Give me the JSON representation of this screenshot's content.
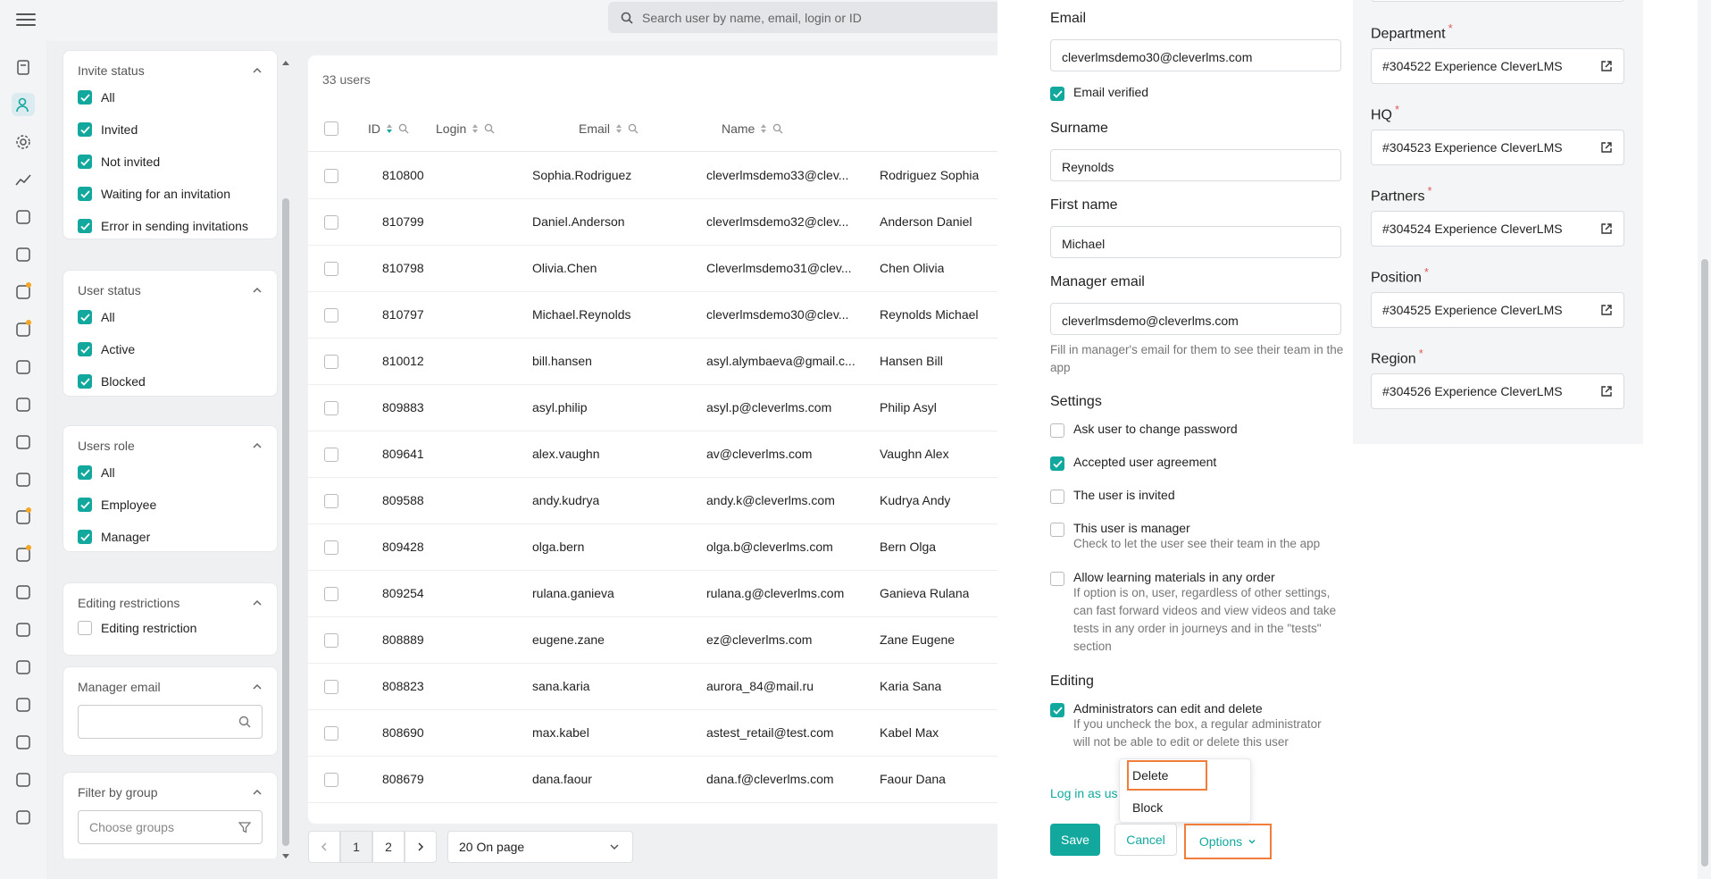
{
  "topbar": {
    "search_placeholder": "Search user by name, email, login or ID"
  },
  "rail": {
    "icons": [
      "edit-doc-icon",
      "users-icon",
      "gear-icon",
      "chart-icon",
      "clipboard-icon",
      "document-icon",
      "tools-icon",
      "target-icon",
      "checklist-icon",
      "help-bubble-icon",
      "calendar-icon",
      "info-icon",
      "chat-icon",
      "video-icon",
      "trophy-icon",
      "gift-icon",
      "user-check-icon",
      "trend-icon",
      "star-icon",
      "monitor-icon",
      "export-icon"
    ],
    "active": "users-icon",
    "accent": "#13a89e",
    "badge_color": "#f5a623"
  },
  "filters": {
    "invite_status": {
      "title": "Invite status",
      "options": [
        {
          "label": "All",
          "checked": true
        },
        {
          "label": "Invited",
          "checked": true
        },
        {
          "label": "Not invited",
          "checked": true
        },
        {
          "label": "Waiting for an invitation",
          "checked": true
        },
        {
          "label": "Error in sending invitations",
          "checked": true
        }
      ]
    },
    "user_status": {
      "title": "User status",
      "options": [
        {
          "label": "All",
          "checked": true
        },
        {
          "label": "Active",
          "checked": true
        },
        {
          "label": "Blocked",
          "checked": true
        }
      ]
    },
    "users_role": {
      "title": "Users role",
      "options": [
        {
          "label": "All",
          "checked": true
        },
        {
          "label": "Employee",
          "checked": true
        },
        {
          "label": "Manager",
          "checked": true
        }
      ]
    },
    "editing_restrictions": {
      "title": "Editing restrictions",
      "options": [
        {
          "label": "Editing restriction",
          "checked": false
        }
      ]
    },
    "manager_email": {
      "title": "Manager email",
      "value": ""
    },
    "filter_by_group": {
      "title": "Filter by group",
      "placeholder": "Choose groups"
    }
  },
  "table": {
    "count": "33 users",
    "columns": [
      "ID",
      "Login",
      "Email",
      "Name"
    ],
    "rows": [
      {
        "id": "810800",
        "login": "Sophia.Rodriguez",
        "email": "cleverlmsdemo33@clev...",
        "name": "Rodriguez Sophia"
      },
      {
        "id": "810799",
        "login": "Daniel.Anderson",
        "email": "cleverlmsdemo32@clev...",
        "name": "Anderson Daniel"
      },
      {
        "id": "810798",
        "login": "Olivia.Chen",
        "email": "Cleverlmsdemo31@clev...",
        "name": "Chen Olivia"
      },
      {
        "id": "810797",
        "login": "Michael.Reynolds",
        "email": "cleverlmsdemo30@clev...",
        "name": "Reynolds Michael"
      },
      {
        "id": "810012",
        "login": "bill.hansen",
        "email": "asyl.alymbaeva@gmail.c...",
        "name": "Hansen Bill"
      },
      {
        "id": "809883",
        "login": "asyl.philip",
        "email": "asyl.p@cleverlms.com",
        "name": "Philip Asyl"
      },
      {
        "id": "809641",
        "login": "alex.vaughn",
        "email": "av@cleverlms.com",
        "name": "Vaughn Alex"
      },
      {
        "id": "809588",
        "login": "andy.kudrya",
        "email": "andy.k@cleverlms.com",
        "name": "Kudrya Andy"
      },
      {
        "id": "809428",
        "login": "olga.bern",
        "email": "olga.b@cleverlms.com",
        "name": "Bern Olga"
      },
      {
        "id": "809254",
        "login": "rulana.ganieva",
        "email": "rulana.g@cleverlms.com",
        "name": "Ganieva Rulana"
      },
      {
        "id": "808889",
        "login": "eugene.zane",
        "email": "ez@cleverlms.com",
        "name": "Zane Eugene"
      },
      {
        "id": "808823",
        "login": "sana.karia",
        "email": "aurora_84@mail.ru",
        "name": "Karia Sana"
      },
      {
        "id": "808690",
        "login": "max.kabel",
        "email": "astest_retail@test.com",
        "name": "Kabel Max"
      },
      {
        "id": "808679",
        "login": "dana.faour",
        "email": "dana.f@cleverlms.com",
        "name": "Faour Dana"
      }
    ]
  },
  "pagination": {
    "pages": [
      "1",
      "2"
    ],
    "current": "1",
    "per_page": "20 On page"
  },
  "panel": {
    "email_label": "Email",
    "email_value": "cleverlmsdemo30@cleverlms.com",
    "email_verified_label": "Email verified",
    "surname_label": "Surname",
    "surname_value": "Reynolds",
    "firstname_label": "First name",
    "firstname_value": "Michael",
    "manager_email_label": "Manager email",
    "manager_email_value": "cleverlmsdemo@cleverlms.com",
    "manager_email_hint": "Fill in manager's email for them to see their team in the app",
    "settings_title": "Settings",
    "settings": [
      {
        "label": "Ask user to change password",
        "checked": false,
        "sub": ""
      },
      {
        "label": "Accepted user agreement",
        "checked": true,
        "sub": ""
      },
      {
        "label": "The user is invited",
        "checked": false,
        "sub": ""
      },
      {
        "label": "This user is manager",
        "checked": false,
        "sub": "Check to let the user see their team in the app"
      },
      {
        "label": "Allow learning materials in any order",
        "checked": false,
        "sub": "If option is on, user, regardless of other settings, can fast forward videos and view videos and take tests in any order in journeys and in the \"tests\" section"
      }
    ],
    "editing_title": "Editing",
    "editing_label": "Administrators can edit and delete",
    "editing_sub": "If you uncheck the box, a regular administrator will not be able to edit or delete this user",
    "login_as_link": "Log in as us",
    "save": "Save",
    "cancel": "Cancel",
    "options": "Options",
    "menu": [
      "Delete",
      "Block"
    ],
    "highlight_color": "#f07d3a"
  },
  "attributes": [
    {
      "label": "Department",
      "value": "#304522 Experience CleverLMS"
    },
    {
      "label": "HQ",
      "value": "#304523 Experience CleverLMS"
    },
    {
      "label": "Partners",
      "value": "#304524 Experience CleverLMS"
    },
    {
      "label": "Position",
      "value": "#304525 Experience CleverLMS"
    },
    {
      "label": "Region",
      "value": "#304526 Experience CleverLMS"
    }
  ],
  "required_mark": "*"
}
